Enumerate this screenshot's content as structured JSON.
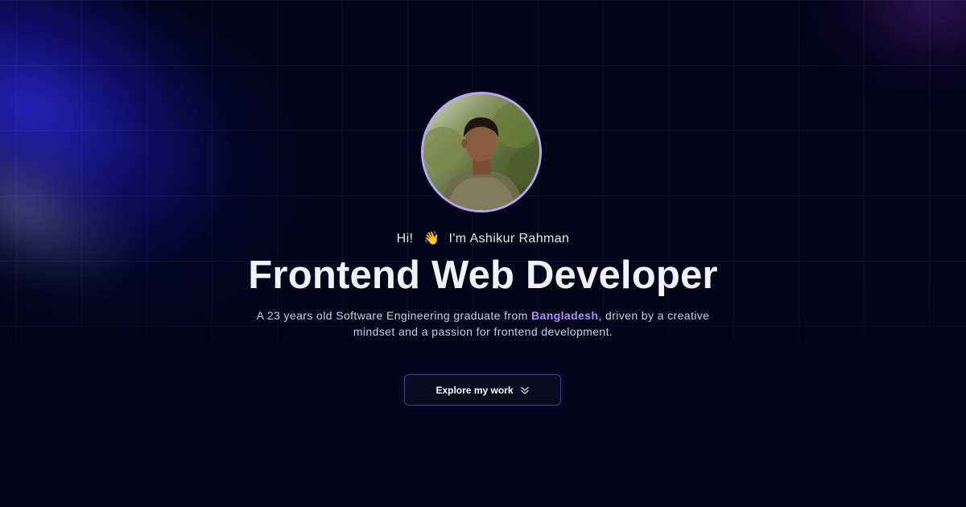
{
  "hero": {
    "greeting_prefix": "Hi!",
    "greeting_emoji": "👋",
    "greeting_name": "I'm Ashikur Rahman",
    "headline": "Frontend Web Developer",
    "bio_before": "A 23 years old Software Engineering graduate from ",
    "bio_highlight": "Bangladesh",
    "bio_after": ", driven by a creative mindset and a passion for frontend development.",
    "cta_label": "Explore my work",
    "cta_icon": "chevrons-down-icon"
  },
  "colors": {
    "background": "#03031a",
    "accent": "#b48cf5",
    "avatar_ring": "#b9a7ee",
    "button_border": "#4c3f93"
  }
}
